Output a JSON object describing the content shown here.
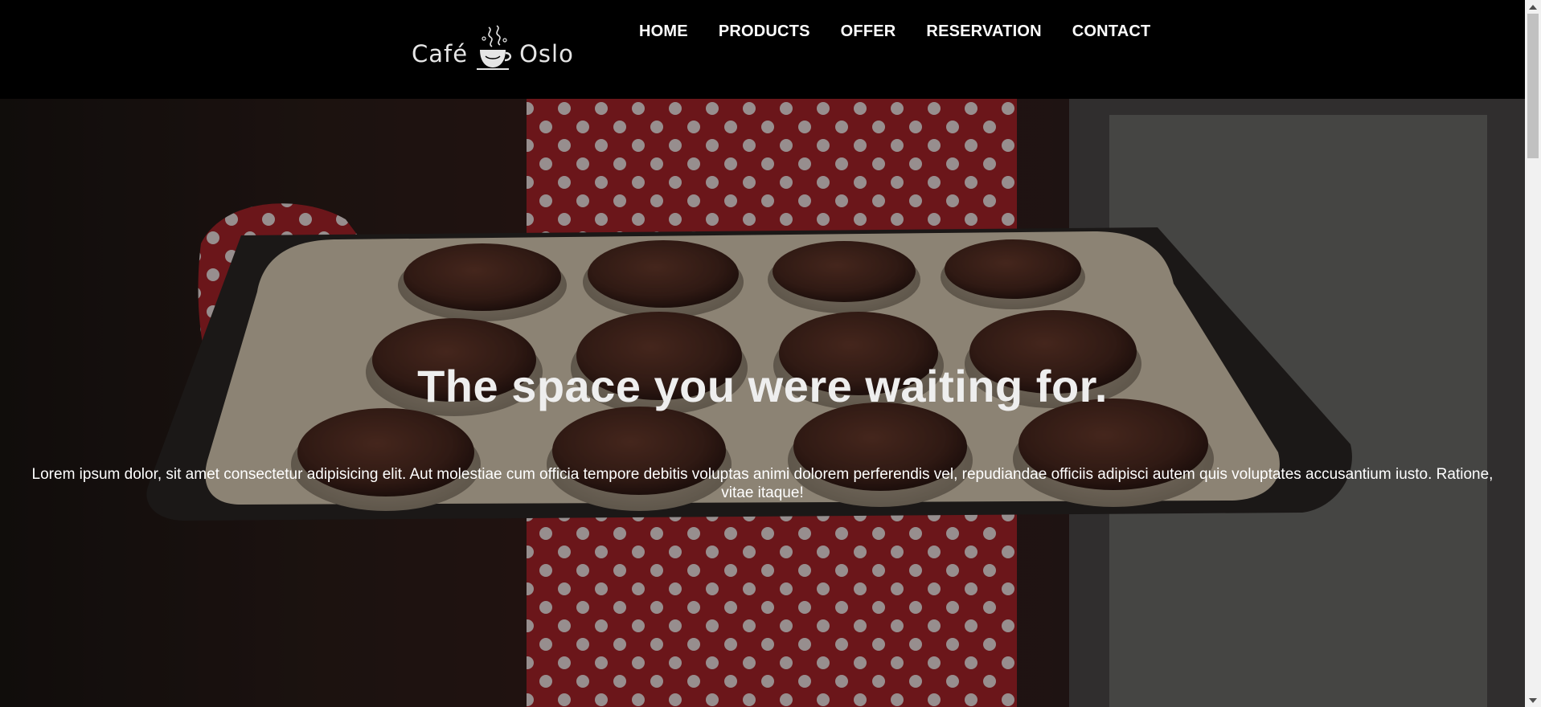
{
  "header": {
    "logo": {
      "word_left": "Café",
      "word_right": "Oslo"
    },
    "nav": [
      {
        "label": "HOME"
      },
      {
        "label": "PRODUCTS"
      },
      {
        "label": "OFFER"
      },
      {
        "label": "RESERVATION"
      },
      {
        "label": "CONTACT"
      }
    ]
  },
  "hero": {
    "title": "The space you were waiting for.",
    "text": "Lorem ipsum dolor, sit amet consectetur adipisicing elit. Aut molestiae cum officia tempore debitis voluptas animi dolorem perferendis vel, repudiandae officiis adipisci autem quis voluptates accusantium iusto. Ratione, vitae itaque!",
    "image": "baking-tray-muffins"
  },
  "icons": {
    "logo": "coffee-cup-icon",
    "scroll_up": "scroll-up-arrow-icon",
    "scroll_down": "scroll-down-arrow-icon"
  },
  "colors": {
    "header_bg": "#000000",
    "nav_text": "#ffffff",
    "hero_title": "#eeeeee",
    "apron_red": "#b2232a",
    "tray": "#e7d9c2",
    "muffin": "#4b2a20"
  }
}
